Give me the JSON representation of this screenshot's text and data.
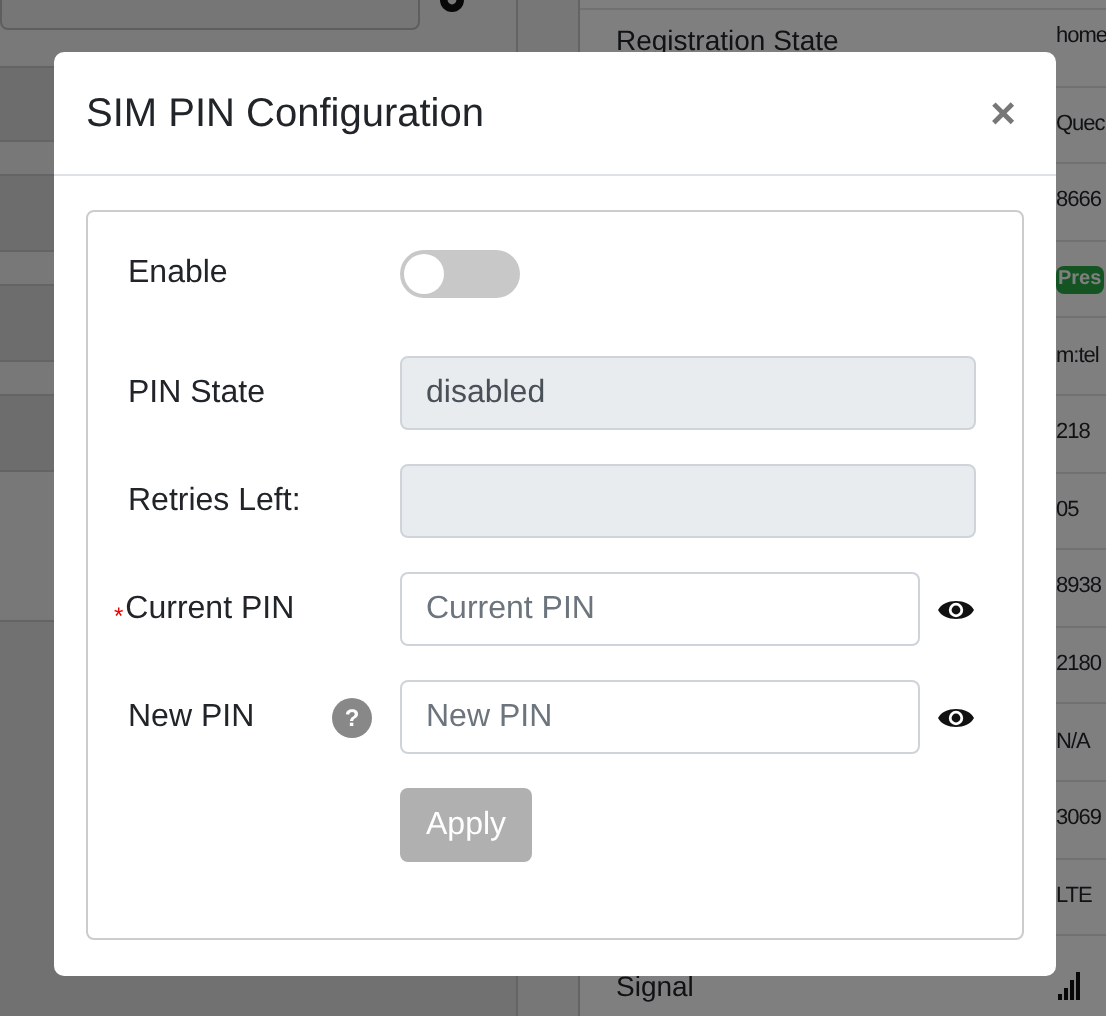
{
  "status_table": {
    "rows": [
      {
        "kind": "text",
        "label": "Registration State",
        "value": "home"
      },
      {
        "kind": "text",
        "value": "Quec"
      },
      {
        "kind": "text",
        "value": "8666"
      },
      {
        "kind": "badge",
        "value": "Pres"
      },
      {
        "kind": "text",
        "value": "m:tel"
      },
      {
        "kind": "text",
        "value": "218"
      },
      {
        "kind": "text",
        "value": "05"
      },
      {
        "kind": "text",
        "value": "8938"
      },
      {
        "kind": "text",
        "value": "2180"
      },
      {
        "kind": "text",
        "value": "N/A"
      },
      {
        "kind": "text",
        "value": "3069"
      },
      {
        "kind": "text",
        "value": "LTE"
      },
      {
        "kind": "signal",
        "label": "Signal"
      }
    ]
  },
  "dialog": {
    "title": "SIM PIN Configuration",
    "close": "×",
    "fields": [
      {
        "kind": "toggle",
        "label": "Enable",
        "on": false
      },
      {
        "kind": "readonly",
        "label": "PIN State",
        "value": "disabled"
      },
      {
        "kind": "readonly",
        "label": "Retries Left:"
      },
      {
        "kind": "password",
        "label": "Current PIN",
        "required_mark": "*",
        "placeholder": "Current PIN"
      },
      {
        "kind": "password",
        "label": "New PIN",
        "help": "?",
        "placeholder": "New PIN"
      }
    ],
    "apply": {
      "label": "Apply",
      "disabled": true
    }
  }
}
